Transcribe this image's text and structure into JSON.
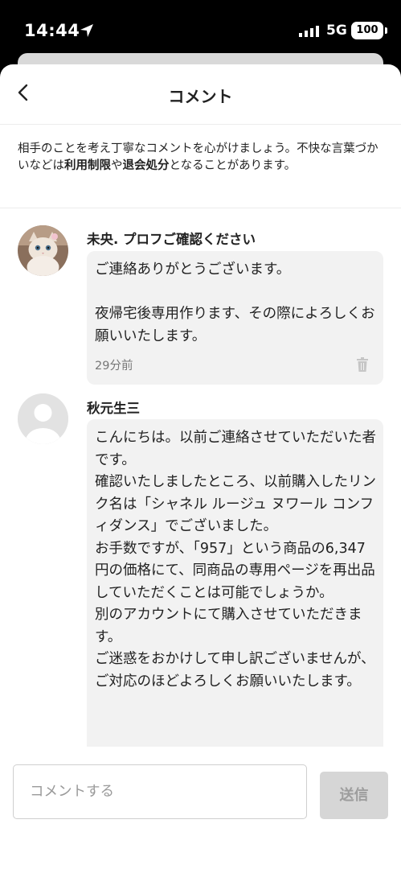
{
  "status_bar": {
    "time": "14:44",
    "network": "5G",
    "battery": "100"
  },
  "header": {
    "title": "コメント"
  },
  "notice": {
    "part1": "相手のことを考え丁寧なコメントを心がけましょう。不快な言葉づかいなどは",
    "bold1": "利用制限",
    "part2": "や",
    "bold2": "退会処分",
    "part3": "となることがあります。"
  },
  "comments": [
    {
      "name": "未央. プロフご確認ください",
      "text": "ご連絡ありがとうございます。\n\n夜帰宅後専用作ります、その際によろしくお願いいたします。",
      "timestamp": "29分前",
      "avatar": "cat-photo"
    },
    {
      "name": "秋元生三",
      "text": "こんにちは。以前ご連絡させていただいた者です。\n確認いたしましたところ、以前購入したリンク名は「シャネル ルージュ ヌワール コンフィダンス」でございました。\nお手数ですが、「957」という商品の6,347円の価格にて、同商品の専用ページを再出品していただくことは可能でしょうか。\n別のアカウントにて購入させていただきます。\nご迷惑をおかけして申し訳ございませんが、ご対応のほどよろしくお願いいたします。",
      "avatar": "default-user"
    }
  ],
  "input": {
    "placeholder": "コメントする",
    "send_label": "送信"
  },
  "colors": {
    "bubble": "#f2f2f2",
    "send_disabled": "#d6d6d6"
  }
}
